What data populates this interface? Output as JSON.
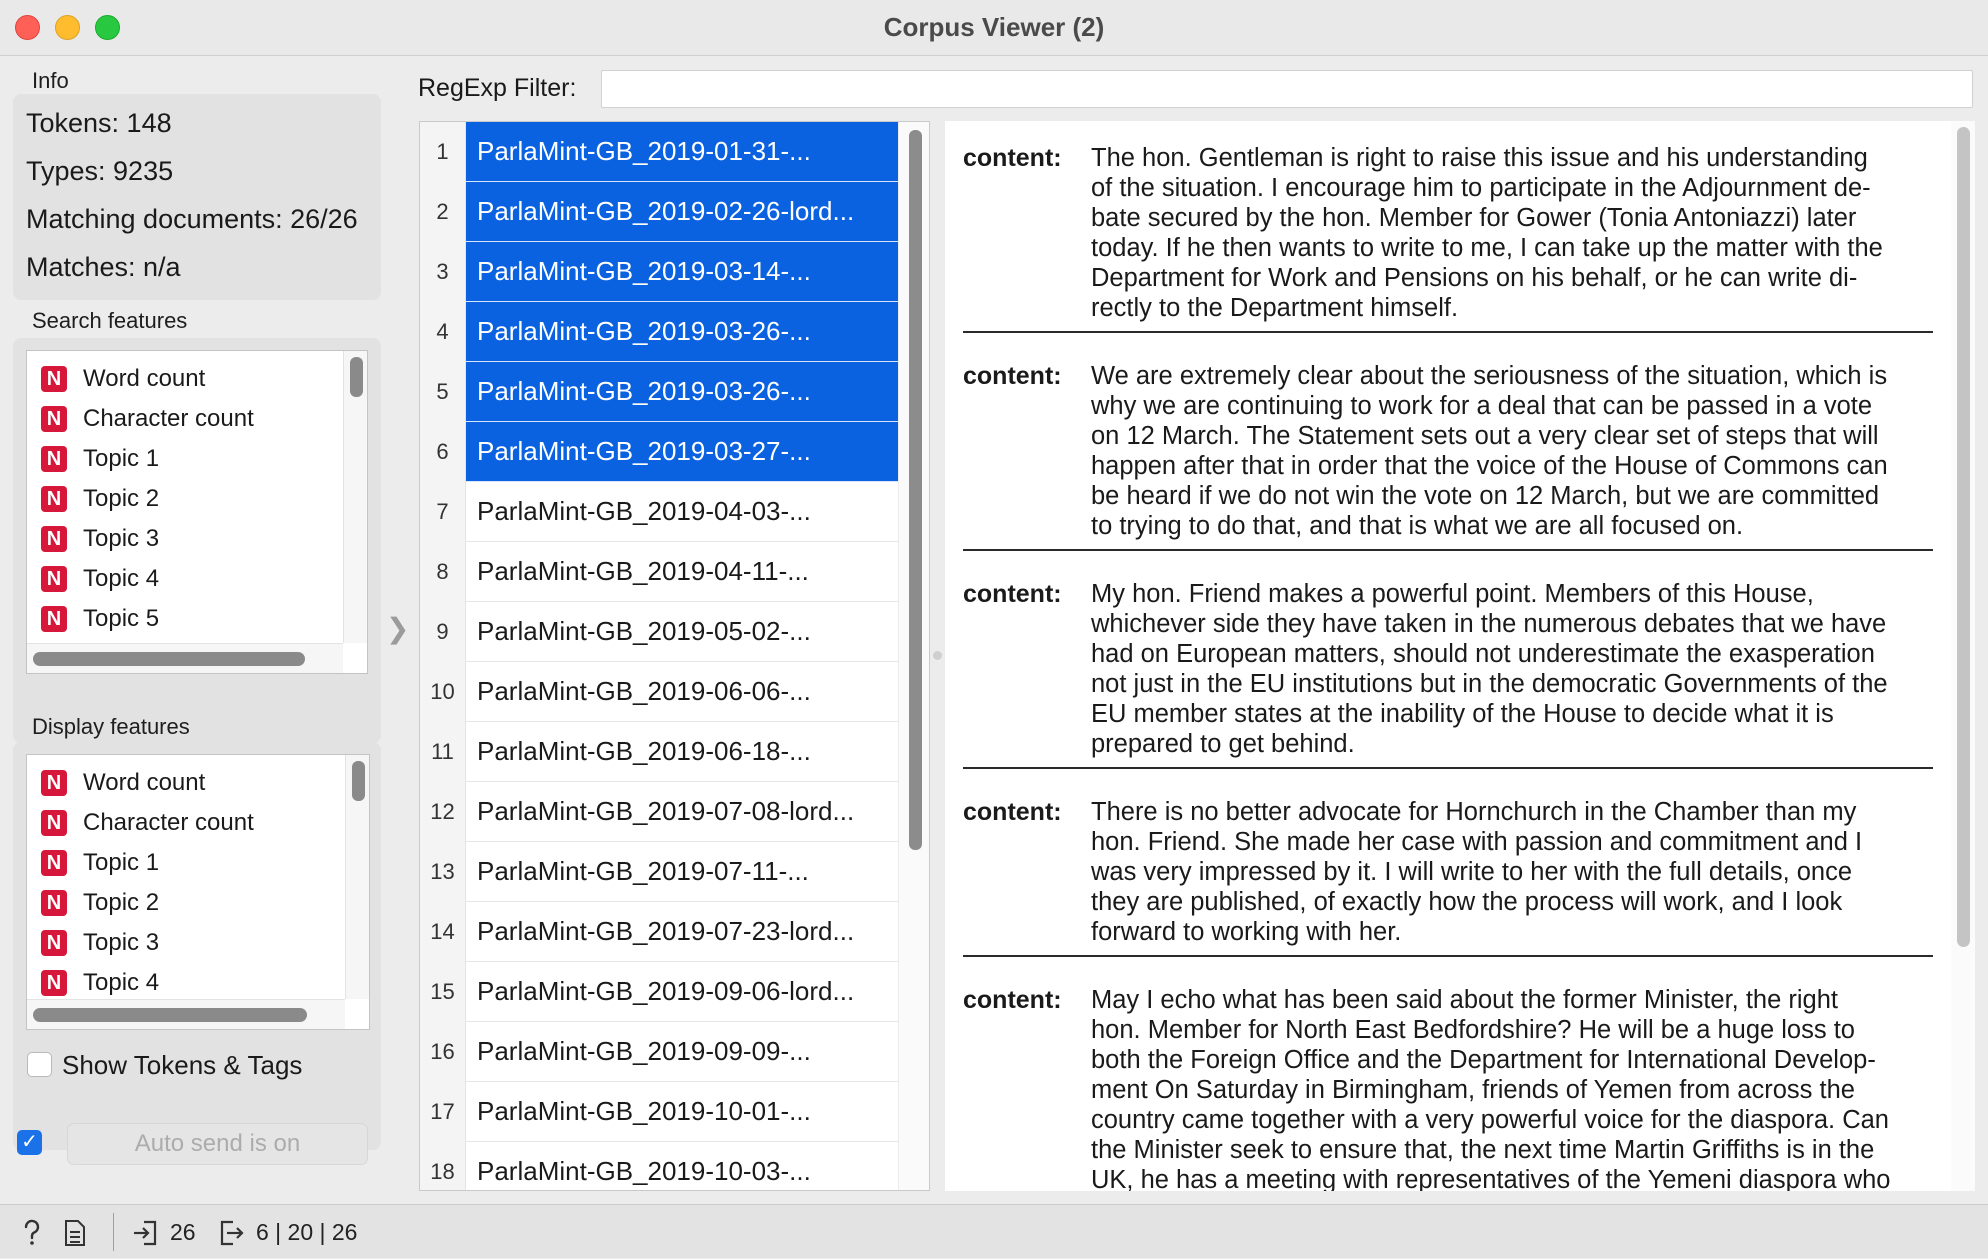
{
  "window": {
    "title": "Corpus Viewer (2)"
  },
  "info": {
    "label": "Info",
    "tokens": "Tokens: 148",
    "types": "Types: 9235",
    "matching": "Matching documents: 26/26",
    "matches": "Matches: n/a"
  },
  "search_features": {
    "label": "Search features",
    "badge": "N",
    "items": [
      "Word count",
      "Character count",
      "Topic 1",
      "Topic 2",
      "Topic 3",
      "Topic 4",
      "Topic 5"
    ]
  },
  "display_features": {
    "label": "Display features",
    "badge": "N",
    "items": [
      "Word count",
      "Character count",
      "Topic 1",
      "Topic 2",
      "Topic 3",
      "Topic 4"
    ]
  },
  "show_tokens": {
    "label": "Show Tokens & Tags",
    "checked": false
  },
  "auto_send": {
    "label": "Auto send is on",
    "checked": true,
    "check_glyph": "✓"
  },
  "filter": {
    "label": "RegExp Filter:",
    "value": ""
  },
  "documents": [
    {
      "num": "1",
      "title": "ParlaMint-GB_2019-01-31-...",
      "selected": true
    },
    {
      "num": "2",
      "title": "ParlaMint-GB_2019-02-26-lord...",
      "selected": true
    },
    {
      "num": "3",
      "title": "ParlaMint-GB_2019-03-14-...",
      "selected": true
    },
    {
      "num": "4",
      "title": "ParlaMint-GB_2019-03-26-...",
      "selected": true
    },
    {
      "num": "5",
      "title": "ParlaMint-GB_2019-03-26-...",
      "selected": true
    },
    {
      "num": "6",
      "title": "ParlaMint-GB_2019-03-27-...",
      "selected": true
    },
    {
      "num": "7",
      "title": "ParlaMint-GB_2019-04-03-...",
      "selected": false
    },
    {
      "num": "8",
      "title": "ParlaMint-GB_2019-04-11-...",
      "selected": false
    },
    {
      "num": "9",
      "title": "ParlaMint-GB_2019-05-02-...",
      "selected": false
    },
    {
      "num": "10",
      "title": "ParlaMint-GB_2019-06-06-...",
      "selected": false
    },
    {
      "num": "11",
      "title": "ParlaMint-GB_2019-06-18-...",
      "selected": false
    },
    {
      "num": "12",
      "title": "ParlaMint-GB_2019-07-08-lord...",
      "selected": false
    },
    {
      "num": "13",
      "title": "ParlaMint-GB_2019-07-11-...",
      "selected": false
    },
    {
      "num": "14",
      "title": "ParlaMint-GB_2019-07-23-lord...",
      "selected": false
    },
    {
      "num": "15",
      "title": "ParlaMint-GB_2019-09-06-lord...",
      "selected": false
    },
    {
      "num": "16",
      "title": "ParlaMint-GB_2019-09-09-...",
      "selected": false
    },
    {
      "num": "17",
      "title": "ParlaMint-GB_2019-10-01-...",
      "selected": false
    },
    {
      "num": "18",
      "title": "ParlaMint-GB_2019-10-03-...",
      "selected": false
    }
  ],
  "content_label": "content:",
  "contents": [
    [
      "The hon. Gentleman is right to raise this issue and his understanding",
      "of the situation. I encourage him to participate in the Adjournment de-",
      "bate secured by the hon. Member for Gower (Tonia Antoniazzi) later",
      "today. If he then wants to write to me, I can take up the matter with the",
      "Department for Work and Pensions on his behalf, or he can write di-",
      "rectly to the Department himself."
    ],
    [
      "We are extremely clear about the seriousness of the situation, which is",
      "why we are continuing to work for a deal that can be passed in a vote",
      "on 12 March. The Statement sets out a very clear set of steps that will",
      "happen after that in order that the voice of the House of Commons can",
      "be heard if we do not win the vote on 12 March, but we are committed",
      "to trying to do that, and that is what we are all focused on."
    ],
    [
      "My hon. Friend makes a powerful point. Members of this House,",
      "whichever side they have taken in the numerous debates that we have",
      "had on European matters, should not underestimate the exasperation",
      "not just in the EU institutions but in the democratic Governments of the",
      "EU member states at the inability of the House to decide what it is",
      "prepared to get behind."
    ],
    [
      "There is no better advocate for Hornchurch in the Chamber than my",
      "hon. Friend. She made her case with passion and commitment and I",
      "was very impressed by it. I will write to her with the full details, once",
      "they are published, of exactly how the process will work, and I look",
      "forward to working with her."
    ],
    [
      "May I echo what has been said about the former Minister, the right",
      "hon. Member for North East Bedfordshire? He will be a huge loss to",
      "both the Foreign Office and the Department for International Develop-",
      "ment On Saturday in Birmingham, friends of Yemen from across the",
      "country came together with a very powerful voice for the diaspora. Can",
      "the Minister seek to ensure that, the next time Martin Griffiths is in the",
      "UK, he has a meeting with representatives of the Yemeni diaspora who"
    ]
  ],
  "status": {
    "input_count": "26",
    "output_counts": "6 | 20 | 26"
  },
  "colors": {
    "selection": "#0b62e1",
    "badge": "#d6163a",
    "checkbox": "#1b72e8"
  }
}
